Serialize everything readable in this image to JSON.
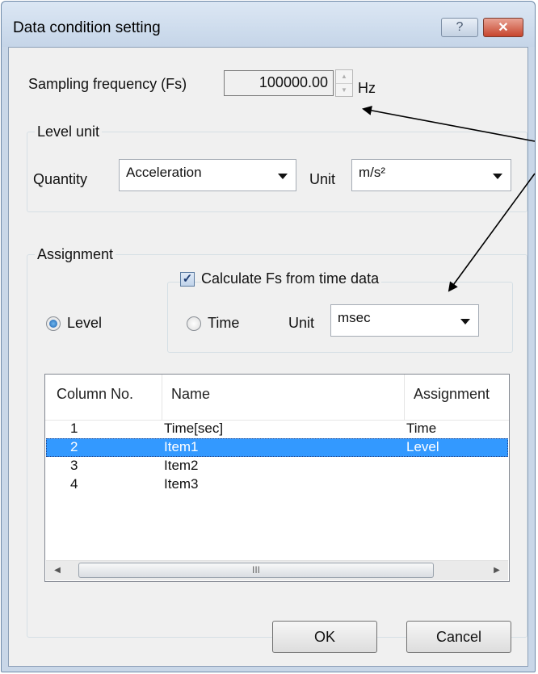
{
  "window": {
    "title": "Data condition setting",
    "help_label": "?",
    "close_label": "✕"
  },
  "sampling": {
    "label": "Sampling frequency (Fs)",
    "value": "100000.00",
    "unit": "Hz"
  },
  "level_unit": {
    "legend": "Level unit",
    "quantity_label": "Quantity",
    "quantity_value": "Acceleration",
    "unit_label": "Unit",
    "unit_value": "m/s²"
  },
  "assignment": {
    "legend": "Assignment",
    "calc_fs_label": "Calculate Fs from time data",
    "calc_fs_checked": true,
    "level_label": "Level",
    "level_selected": true,
    "time_label": "Time",
    "time_selected": false,
    "time_unit_label": "Unit",
    "time_unit_value": "msec"
  },
  "table": {
    "columns": [
      "Column No.",
      "Name",
      "Assignment"
    ],
    "rows": [
      {
        "no": "1",
        "name": "Time[sec]",
        "assignment": "Time",
        "selected": false
      },
      {
        "no": "2",
        "name": "Item1",
        "assignment": "Level",
        "selected": true
      },
      {
        "no": "3",
        "name": "Item2",
        "assignment": "",
        "selected": false
      },
      {
        "no": "4",
        "name": "Item3",
        "assignment": "",
        "selected": false
      }
    ],
    "scroll_thumb_label": "III"
  },
  "buttons": {
    "ok": "OK",
    "cancel": "Cancel"
  },
  "colors": {
    "selection": "#3399ff",
    "annotation_arrow": "#000000"
  }
}
